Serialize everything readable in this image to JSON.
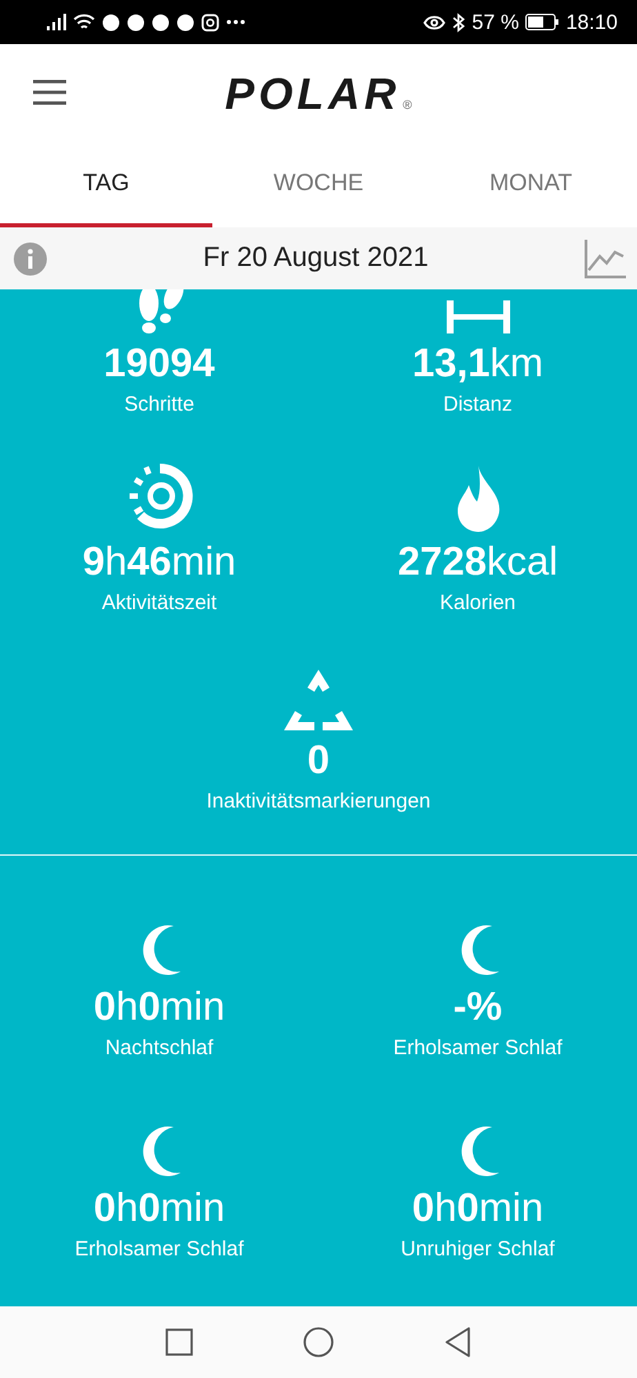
{
  "status_bar": {
    "battery": "57 %",
    "time": "18:10"
  },
  "header": {
    "logo": "POLAR",
    "logo_mark": "®"
  },
  "tabs": [
    {
      "label": "TAG",
      "selected": true
    },
    {
      "label": "WOCHE",
      "selected": false
    },
    {
      "label": "MONAT",
      "selected": false
    }
  ],
  "date_bar": {
    "date": "Fr 20 August 2021"
  },
  "activity": [
    {
      "kind": "steps",
      "value": "**19094**",
      "label": "Schritte"
    },
    {
      "kind": "distance",
      "value": "**13,1**km",
      "label": "Distanz"
    },
    {
      "kind": "activity",
      "value": "**9**h**46**min",
      "label": "Aktivitätszeit"
    },
    {
      "kind": "calories",
      "value": "**2728**kcal",
      "label": "Kalorien"
    },
    {
      "kind": "inactivity",
      "value": "**0**",
      "label": "Inaktivitätsmarkierungen"
    }
  ],
  "sleep": [
    {
      "kind": "moon",
      "value": "**0**h**0**min",
      "label": "Nachtschlaf"
    },
    {
      "kind": "moon",
      "value": "**-%**",
      "label": "Erholsamer Schlaf"
    },
    {
      "kind": "moon",
      "value": "**0**h**0**min",
      "label": "Erholsamer Schlaf"
    },
    {
      "kind": "moon",
      "value": "**0**h**0**min",
      "label": "Unruhiger Schlaf"
    }
  ]
}
